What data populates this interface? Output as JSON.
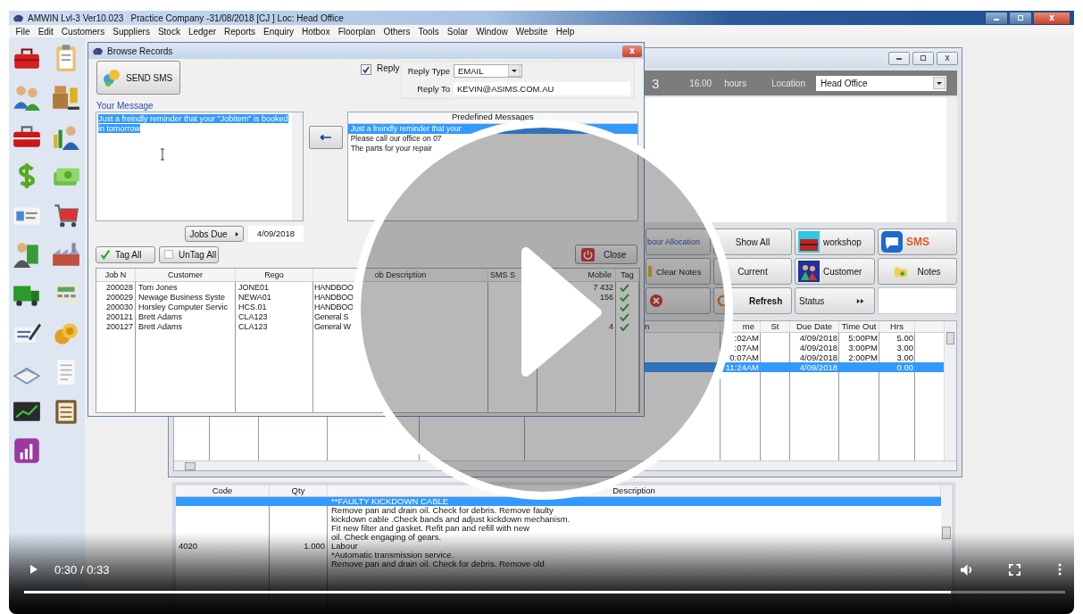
{
  "app_window": {
    "title": "AMWIN Lvl-3 Ver10.023   Practice Company -31/08/2018 [CJ ] Loc: Head Office"
  },
  "menu": [
    "File",
    "Edit",
    "Customers",
    "Suppliers",
    "Stock",
    "Ledger",
    "Reports",
    "Enquiry",
    "Hotbox",
    "Floorplan",
    "Others",
    "Tools",
    "Solar",
    "Window",
    "Website",
    "Help"
  ],
  "dialog": {
    "title": "Browse Records",
    "send_button": "SEND SMS",
    "reply": {
      "label": "Reply",
      "checked": true
    },
    "reply_type": {
      "label": "Reply Type",
      "value": "EMAIL"
    },
    "reply_to": {
      "label": "Reply To",
      "value": "KEVIN@ASIMS.COM.AU"
    },
    "message_label": "Your Message",
    "message": {
      "text": "Just a freindly reminder that your \"Jobitem\" is booked in tomorrow",
      "selected": true
    },
    "predefined": {
      "title": "Predefined Messages",
      "items": [
        {
          "text": "Just a freindly reminder that your",
          "selected": true
        },
        {
          "text": "Please call our office on 07",
          "selected": false
        },
        {
          "text": "The parts for your repair",
          "selected": false
        }
      ]
    },
    "jobs_due": {
      "label": "Jobs Due",
      "date": "4/09/2018"
    },
    "tag_all": "Tag All",
    "untag_all": "UnTag All",
    "close": "Close",
    "table": {
      "columns": [
        "Job N",
        "Customer",
        "Rego",
        "ob Description",
        "SMS S",
        "Mobile",
        "Tag"
      ],
      "rows": [
        {
          "job": "200028",
          "customer": "Tom Jones",
          "rego": "JONE01",
          "description": "HANDBOO",
          "mobile": "7 432",
          "tagged": true
        },
        {
          "job": "200029",
          "customer": "Newage Business Syste",
          "rego": "NEWA01",
          "description": "HANDBOO",
          "mobile": "156",
          "tagged": true
        },
        {
          "job": "200030",
          "customer": "Horsley Computer Servic",
          "rego": "HCS.01",
          "description": "HANDBOO",
          "tagged": true
        },
        {
          "job": "200121",
          "customer": "Brett Adams",
          "rego": "CLA123",
          "description": "General S",
          "tagged": true
        },
        {
          "job": "200127",
          "customer": "Brett Adams",
          "rego": "CLA123",
          "description": "General W",
          "mobile": "4",
          "tagged": true
        }
      ]
    }
  },
  "job_window": {
    "header": {
      "number": "3",
      "hours": "16.00",
      "hours_unit": "hours",
      "location_label": "Location",
      "location": "Head Office"
    },
    "buttons": [
      {
        "kind": "link",
        "label": "bour Allocation"
      },
      {
        "kind": "plain",
        "label": "Show All"
      },
      {
        "kind": "workshop",
        "label": "workshop"
      },
      {
        "kind": "sms",
        "label": "SMS"
      },
      {
        "kind": "clear",
        "label": "Clear Notes"
      },
      {
        "kind": "plain",
        "label": "Current"
      },
      {
        "kind": "customer",
        "label": "Customer"
      },
      {
        "kind": "notes",
        "label": "Notes"
      },
      {
        "kind": "delete"
      },
      {
        "kind": "refresh",
        "label": "Refresh"
      },
      {
        "kind": "status",
        "label": "Status"
      },
      {
        "kind": "blank"
      }
    ],
    "table": {
      "columns": [
        "n",
        "me",
        "St",
        "Due Date",
        "Time Out",
        "Hrs"
      ],
      "rows": [
        {
          "time": ":02AM",
          "due": "4/09/2018",
          "out": "5:00PM",
          "hrs": "5.00",
          "selected": false
        },
        {
          "time": ":07AM",
          "due": "4/09/2018",
          "out": "3:00PM",
          "hrs": "3.00",
          "selected": false
        },
        {
          "time": "0:07AM",
          "due": "4/09/2018",
          "out": "2:00PM",
          "hrs": "3.00",
          "selected": false
        },
        {
          "time": "11:24AM",
          "due": "4/09/2018",
          "hrs": "0.00",
          "selected": true
        }
      ]
    }
  },
  "parts": {
    "columns": [
      "Code",
      "Qty",
      "Description"
    ],
    "rows": [
      {
        "description": "**FAULTY KICKDOWN CABLE",
        "selected": true
      },
      {
        "description": "Remove pan and drain oil. Check for debris. Remove faulty",
        "selected": false
      },
      {
        "description": "kickdown cable .Check bands and adjust kickdown mechanism.",
        "selected": false
      },
      {
        "description": "Fit new filter and gasket. Refit pan and refill with new",
        "selected": false
      },
      {
        "description": "oil. Check engaging of gears.",
        "selected": false
      },
      {
        "code": "4020",
        "qty": "1.000",
        "description": "Labour",
        "selected": false
      },
      {
        "description": "*Automatic transmission service.",
        "selected": false
      },
      {
        "description": "Remove pan and drain oil. Check for debris. Remove old",
        "selected": false
      }
    ]
  },
  "player": {
    "time": "0:30 / 0:33",
    "level": 0.89
  }
}
